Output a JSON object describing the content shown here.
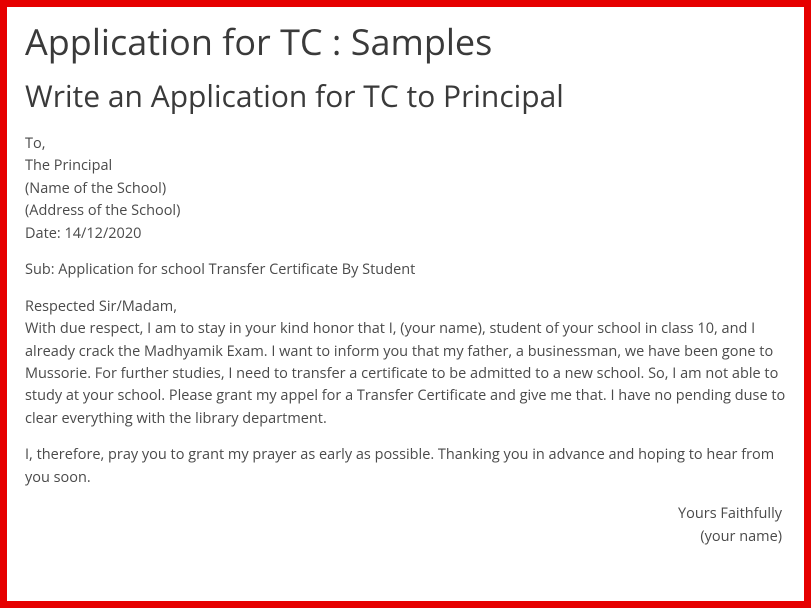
{
  "title": "Application for TC : Samples",
  "subtitle": "Write an Application for TC to Principal",
  "addressBlock": {
    "to": "To,",
    "principal": "The Principal",
    "schoolName": "(Name of the School)",
    "schoolAddress": "(Address of the School)",
    "date": "Date: 14/12/2020"
  },
  "subjectLine": "Sub: Application for school Transfer Certificate By Student",
  "salutation": "Respected Sir/Madam,",
  "body1": "With due respect, I am to stay in your kind honor that I, (your name), student of your school in class 10, and I already crack the Madhyamik Exam. I want to inform you that my father, a businessman, we have been gone to Mussorie. For further studies, I need to transfer a certificate to be admitted to a new school. So, I am not able to study at your school. Please grant my appel for a Transfer Certificate and give me that. I have no pending duse to clear everything with the library department.",
  "body2": "I, therefore, pray you to grant my prayer as early as possible. Thanking you in advance and hoping to hear from you soon.",
  "closing": {
    "valediction": "Yours Faithfully",
    "signature": "(your name)"
  }
}
